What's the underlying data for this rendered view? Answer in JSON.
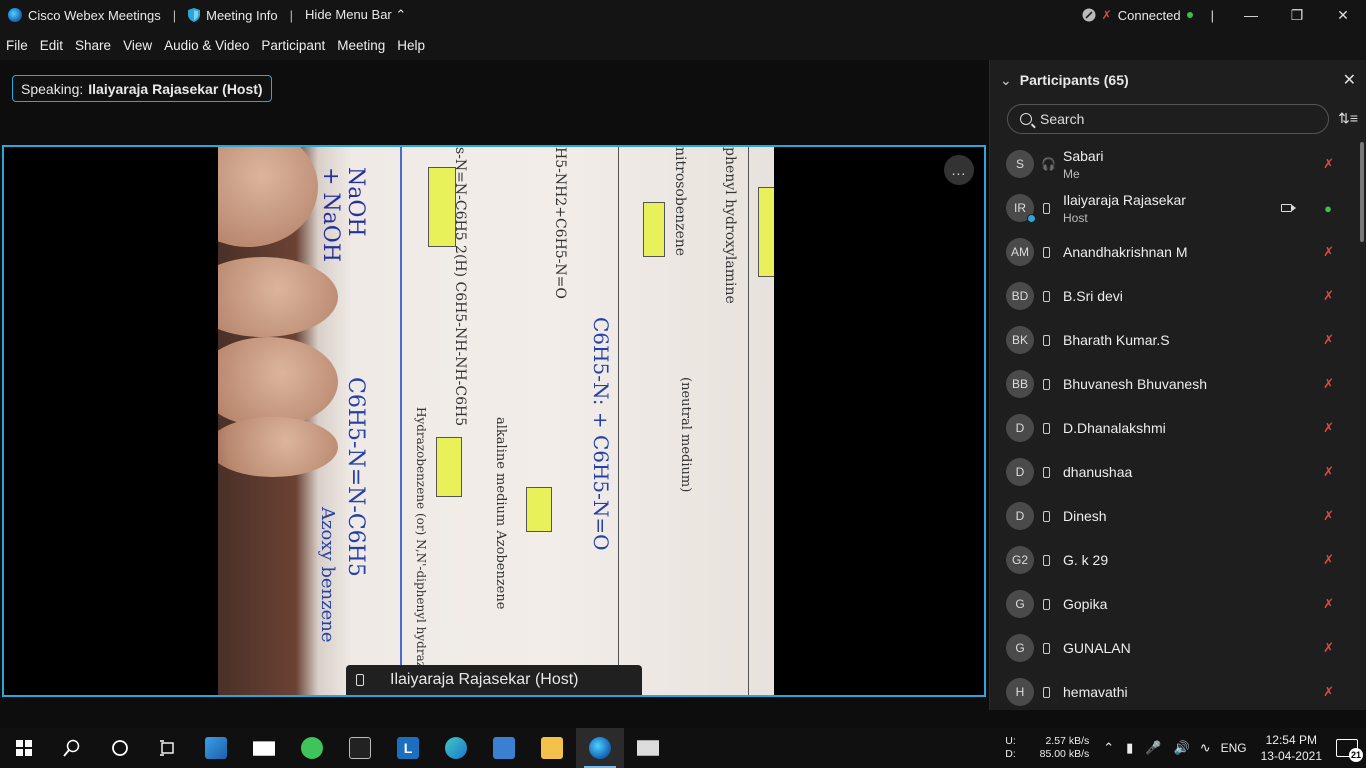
{
  "titlebar": {
    "app_title": "Cisco Webex Meetings",
    "meeting_info": "Meeting Info",
    "hide_menu_bar": "Hide Menu Bar",
    "connection_status": "Connected"
  },
  "menu": [
    "File",
    "Edit",
    "Share",
    "View",
    "Audio & Video",
    "Participant",
    "Meeting",
    "Help"
  ],
  "stage": {
    "speaking_label": "Speaking:",
    "speaking_name": "Ilaiyaraja Rajasekar (Host)",
    "video_name": "Ilaiyaraja Rajasekar  (Host)",
    "more_options": "..."
  },
  "participants": {
    "header": "Participants (65)",
    "search_placeholder": "Search",
    "list": [
      {
        "initials": "S",
        "name": "Sabari",
        "role": "Me",
        "device": "headset",
        "mic": "muted"
      },
      {
        "initials": "IR",
        "name": "Ilaiyaraja Rajasekar",
        "role": "Host",
        "device": "phone",
        "mic": "on",
        "video": true
      },
      {
        "initials": "AM",
        "name": "Anandhakrishnan M",
        "role": "",
        "device": "phone",
        "mic": "muted"
      },
      {
        "initials": "BD",
        "name": "B.Sri devi",
        "role": "",
        "device": "phone",
        "mic": "muted"
      },
      {
        "initials": "BK",
        "name": "Bharath Kumar.S",
        "role": "",
        "device": "phone",
        "mic": "muted"
      },
      {
        "initials": "BB",
        "name": "Bhuvanesh Bhuvanesh",
        "role": "",
        "device": "phone",
        "mic": "muted"
      },
      {
        "initials": "D",
        "name": "D.Dhanalakshmi",
        "role": "",
        "device": "phone",
        "mic": "muted"
      },
      {
        "initials": "D",
        "name": "dhanushaa",
        "role": "",
        "device": "phone",
        "mic": "muted"
      },
      {
        "initials": "D",
        "name": "Dinesh",
        "role": "",
        "device": "phone",
        "mic": "muted"
      },
      {
        "initials": "G2",
        "name": "G. k 29",
        "role": "",
        "device": "phone",
        "mic": "muted"
      },
      {
        "initials": "G",
        "name": "Gopika",
        "role": "",
        "device": "phone",
        "mic": "muted"
      },
      {
        "initials": "G",
        "name": "GUNALAN",
        "role": "",
        "device": "phone",
        "mic": "muted"
      },
      {
        "initials": "H",
        "name": "hemavathi",
        "role": "",
        "device": "phone",
        "mic": "muted"
      }
    ]
  },
  "taskbar": {
    "net_up_label": "U:",
    "net_up": "2.57 kB/s",
    "net_down_label": "D:",
    "net_down": "85.00 kB/s",
    "language": "ENG",
    "time": "12:54 PM",
    "date": "13-04-2021",
    "notifications": "21"
  },
  "colors": {
    "accent": "#2ba6d8",
    "muted_mic": "#e04848",
    "active_mic": "#3fbf4a"
  }
}
